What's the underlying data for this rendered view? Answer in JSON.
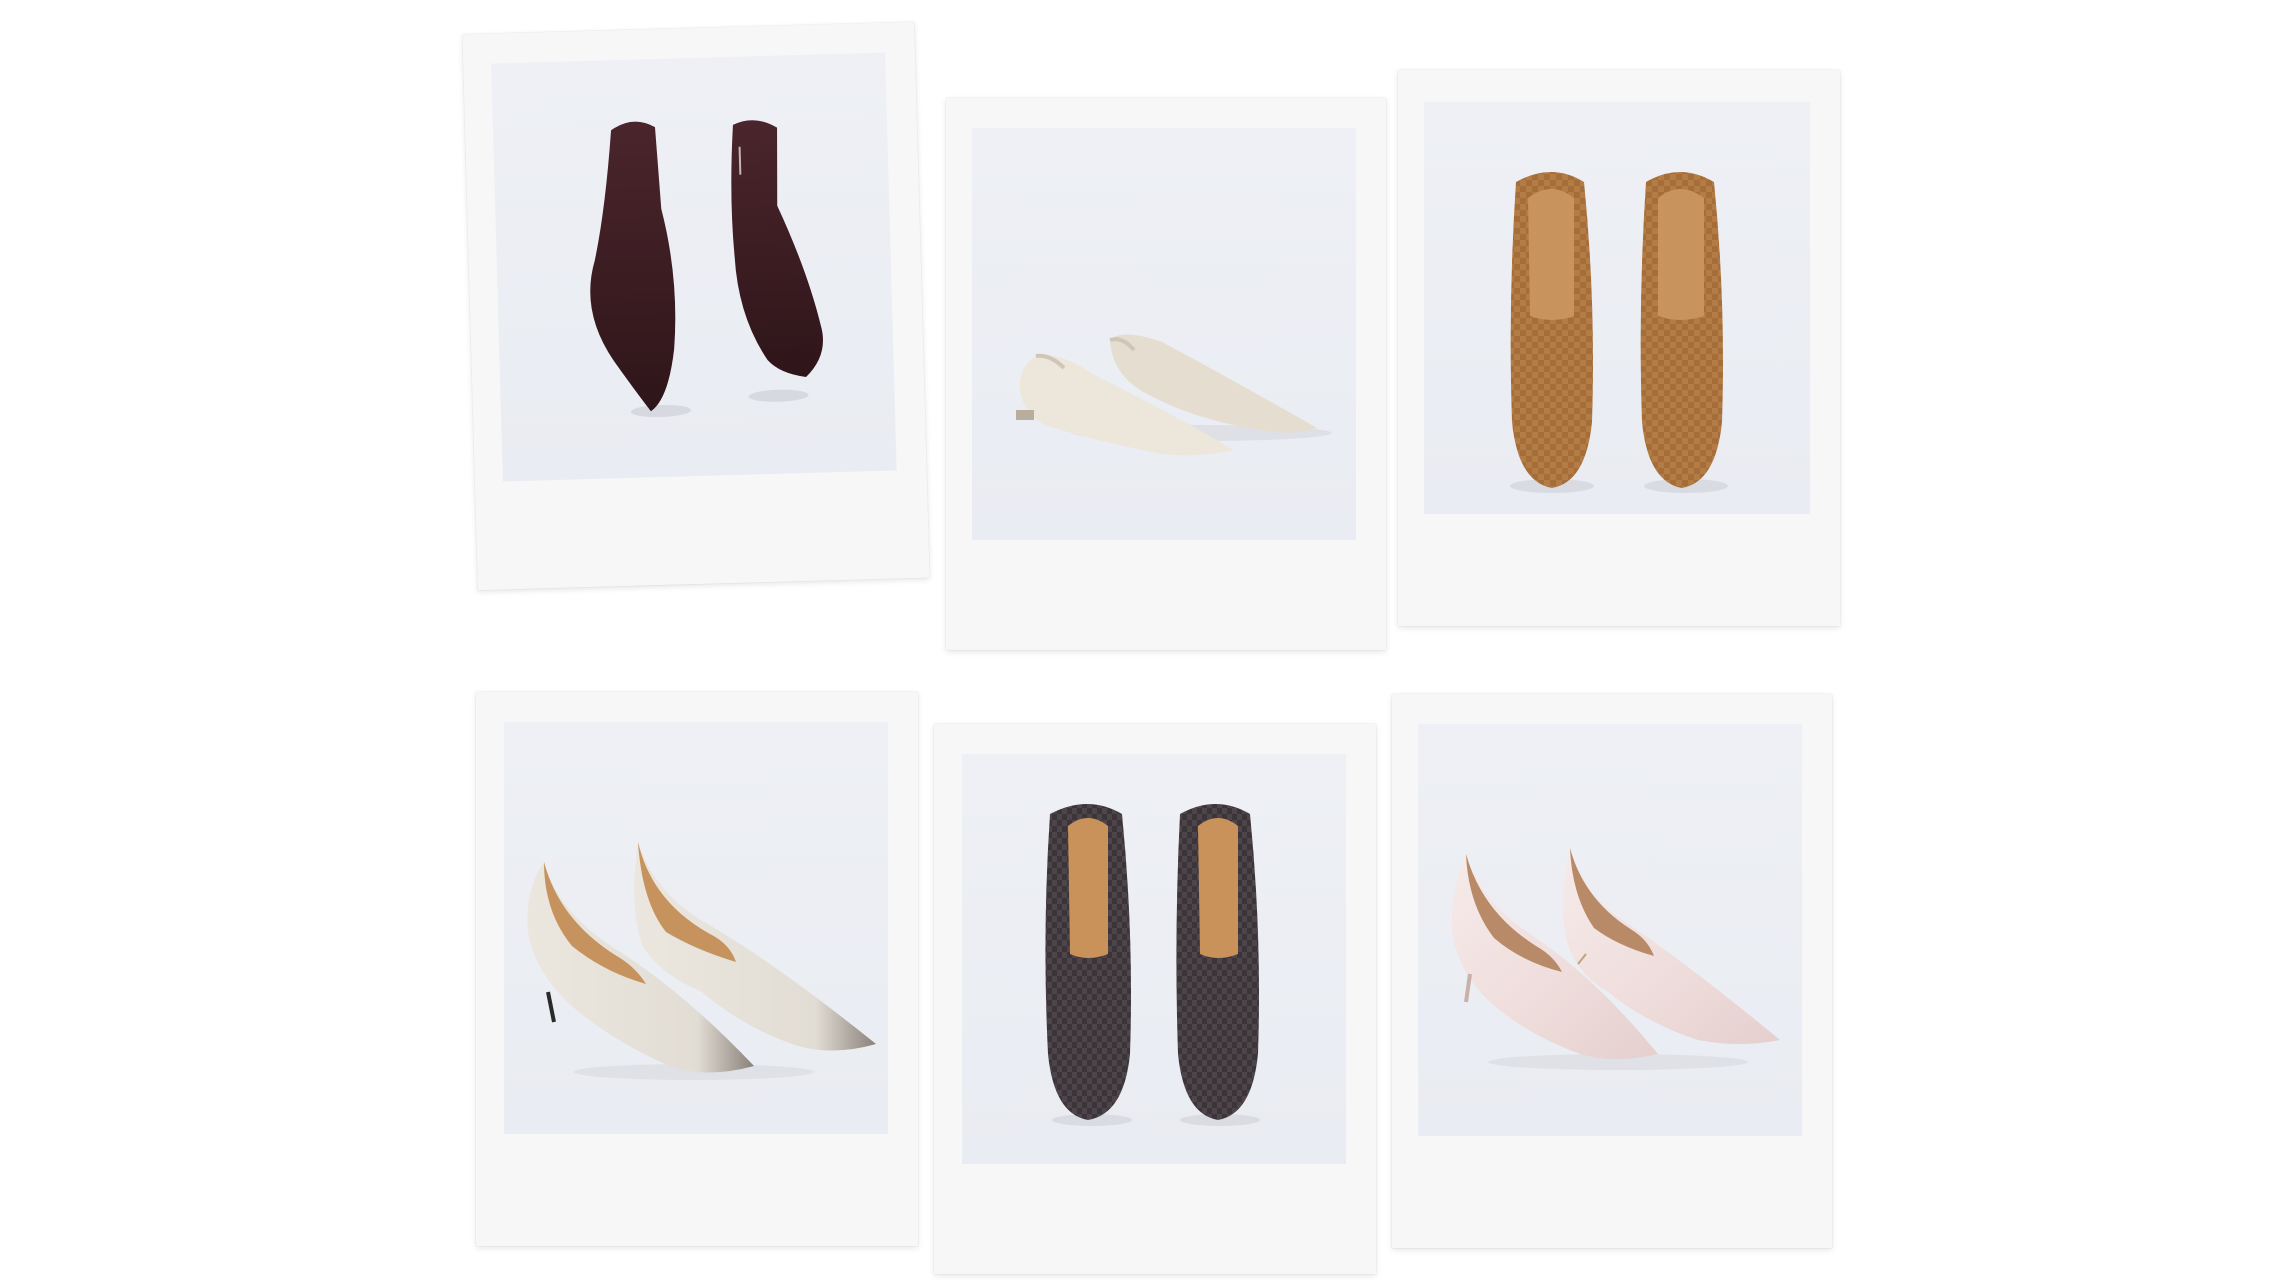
{
  "collage": {
    "polaroids": [
      {
        "item": "burgundy-suede-pointed-ankle-boots",
        "color": "#3d1f24"
      },
      {
        "item": "ivory-leather-slingback-flats",
        "color": "#e8e1d6"
      },
      {
        "item": "tan-woven-suede-loafers",
        "color": "#b07a45"
      },
      {
        "item": "white-pointed-kitten-heel-pumps",
        "color": "#e9e6df"
      },
      {
        "item": "charcoal-woven-suede-loafers",
        "color": "#4a4246"
      },
      {
        "item": "blush-satin-kitten-heel-pumps",
        "color": "#f1e3e2"
      }
    ]
  }
}
